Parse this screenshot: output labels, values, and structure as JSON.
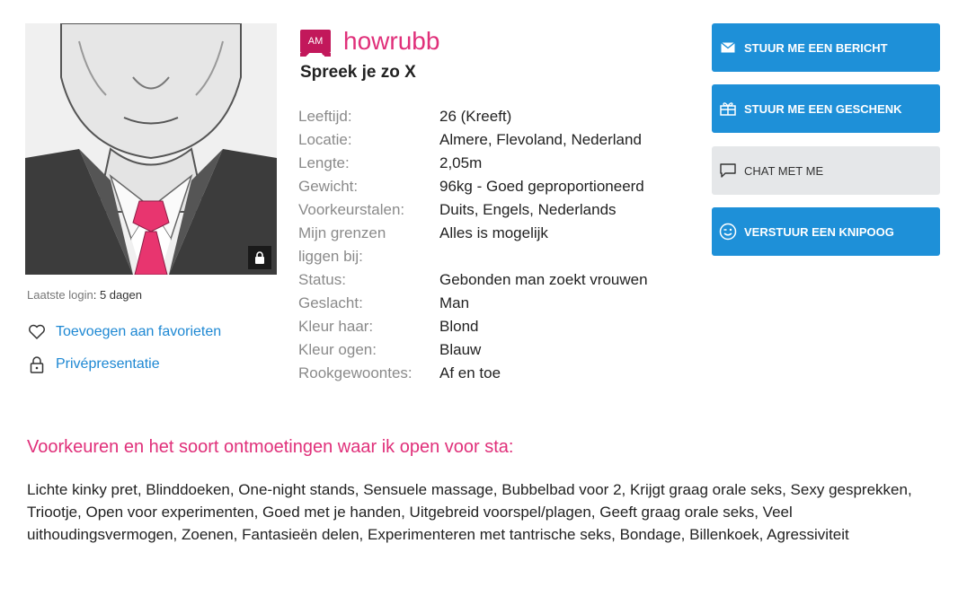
{
  "profile": {
    "badge": "AM",
    "username": "howrubb",
    "subtitle": "Spreek je zo X"
  },
  "sidebar": {
    "last_login_label": "Laatste login",
    "last_login_value": ": 5 dagen",
    "favorite_link": "Toevoegen aan favorieten",
    "private_link": "Privépresentatie"
  },
  "details": [
    {
      "label": "Leeftijd:",
      "value": "26 (Kreeft)"
    },
    {
      "label": "Locatie:",
      "value": "Almere, Flevoland, Nederland"
    },
    {
      "label": "Lengte:",
      "value": "2,05m"
    },
    {
      "label": "Gewicht:",
      "value": "96kg - Goed geproportioneerd"
    },
    {
      "label": "Voorkeurstalen:",
      "value": "Duits, Engels, Nederlands"
    },
    {
      "label": "Mijn grenzen",
      "value": "Alles is mogelijk"
    },
    {
      "label": "liggen bij:",
      "value": ""
    },
    {
      "label": "Status:",
      "value": "Gebonden man zoekt vrouwen"
    },
    {
      "label": "Geslacht:",
      "value": "Man"
    },
    {
      "label": "Kleur haar:",
      "value": "Blond"
    },
    {
      "label": "Kleur ogen:",
      "value": "Blauw"
    },
    {
      "label": "Rookgewoontes:",
      "value": "Af en toe"
    }
  ],
  "actions": {
    "message": "STUUR ME EEN BERICHT",
    "gift": "STUUR ME EEN GESCHENK",
    "chat": "CHAT MET ME",
    "wink": "VERSTUUR EEN KNIPOOG"
  },
  "preferences": {
    "title": "Voorkeuren en het soort ontmoetingen waar ik open voor sta:",
    "text": "Lichte kinky pret, Blinddoeken, One-night stands, Sensuele massage, Bubbelbad voor 2, Krijgt graag orale seks, Sexy gesprekken, Triootje, Open voor experimenten, Goed met je handen, Uitgebreid voorspel/plagen, Geeft graag orale seks, Veel uithoudingsvermogen, Zoenen, Fantasieën delen, Experimenteren met tantrische seks, Bondage, Billenkoek, Agressiviteit"
  },
  "colors": {
    "accent_pink": "#e0307a",
    "brand_badge": "#c2185b",
    "button_blue": "#1e90d8",
    "link_blue": "#1e88d3",
    "tie": "#e8356f"
  },
  "icons": [
    "lock-icon",
    "heart-icon",
    "padlock-icon",
    "envelope-icon",
    "gift-icon",
    "chat-bubble-icon",
    "wink-icon"
  ]
}
